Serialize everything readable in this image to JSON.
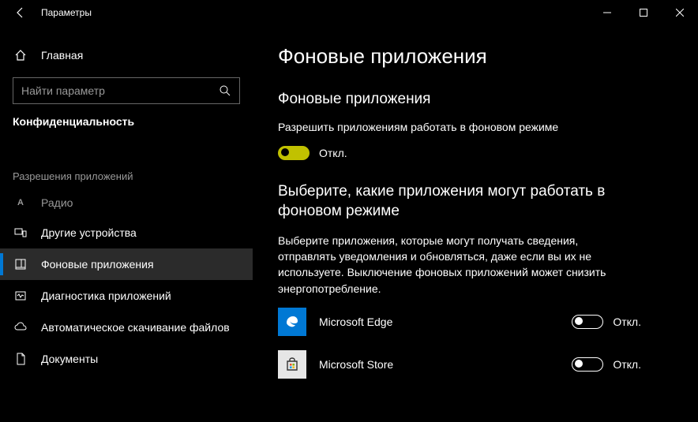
{
  "titlebar": {
    "title": "Параметры"
  },
  "sidebar": {
    "home_label": "Главная",
    "search_placeholder": "Найти параметр",
    "section": "Конфиденциальность",
    "group_heading": "Разрешения приложений",
    "items": [
      {
        "label": "Радио"
      },
      {
        "label": "Другие устройства"
      },
      {
        "label": "Фоновые приложения"
      },
      {
        "label": "Диагностика приложений"
      },
      {
        "label": "Автоматическое скачивание файлов"
      },
      {
        "label": "Документы"
      }
    ]
  },
  "main": {
    "title": "Фоновые приложения",
    "subtitle1": "Фоновые приложения",
    "allow_label": "Разрешить приложениям работать в фоновом режиме",
    "allow_state": "Откл.",
    "subtitle2": "Выберите, какие приложения могут работать в фоновом режиме",
    "desc2": "Выберите приложения, которые могут получать сведения, отправлять уведомления и обновляться, даже если вы их не используете. Выключение фоновых приложений может снизить энергопотребление.",
    "apps": [
      {
        "name": "Microsoft Edge",
        "state": "Откл."
      },
      {
        "name": "Microsoft Store",
        "state": "Откл."
      }
    ]
  }
}
